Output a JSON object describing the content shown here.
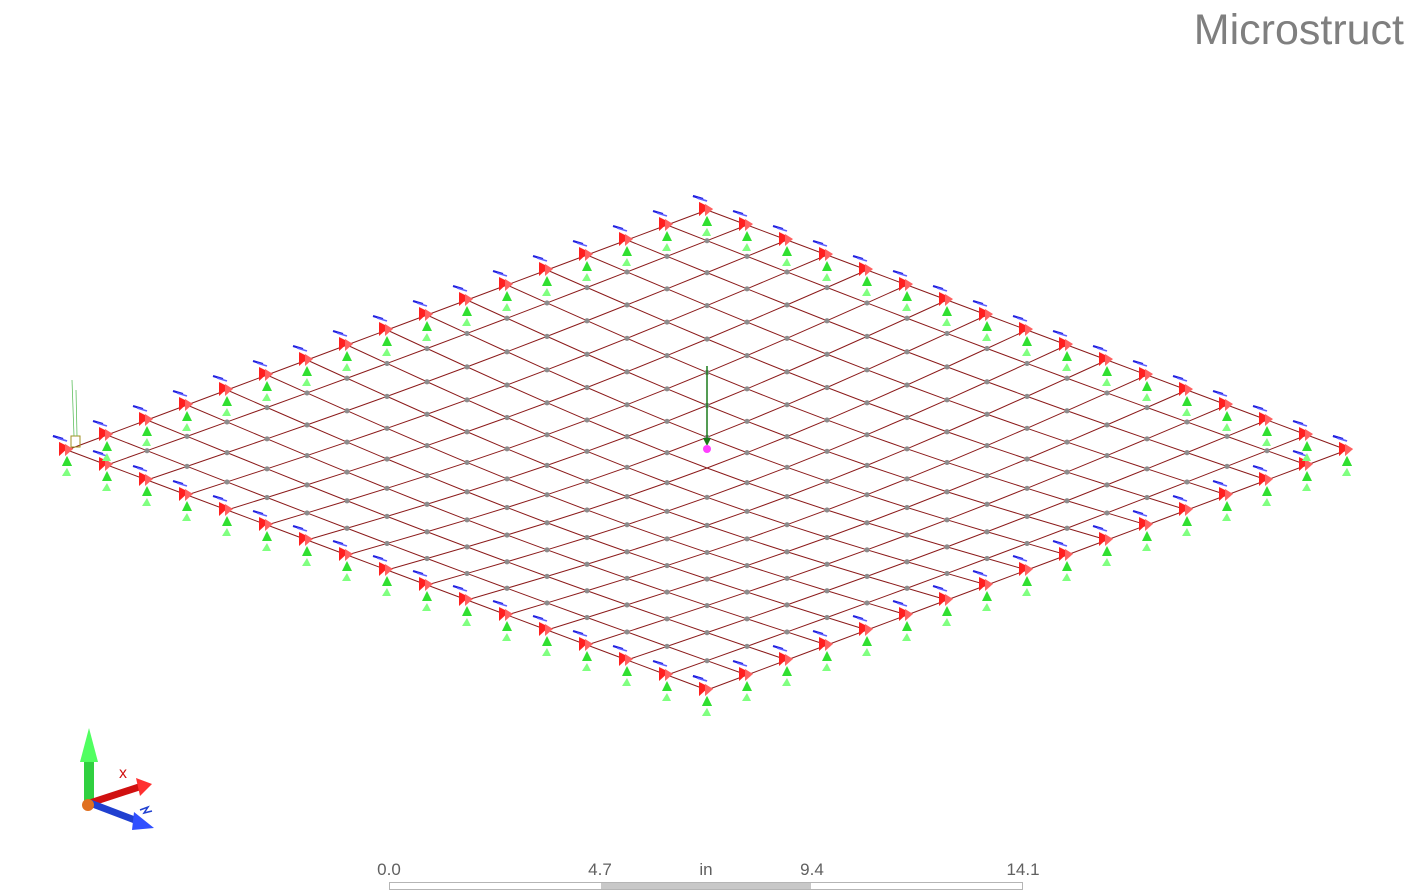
{
  "app": {
    "watermark": "Microstruct"
  },
  "axis_triad": {
    "x_label": "x",
    "icon": "xyz-axis-triad-icon"
  },
  "scale_bar": {
    "ticks": [
      "0.0",
      "4.7",
      "9.4",
      "14.1"
    ],
    "unit": "in",
    "segment_fill": [
      "#ffffff",
      "#c8c8c8",
      "#ffffff"
    ]
  },
  "model": {
    "mesh_color": "#8b1a1a",
    "node_color": "#8c8c8c",
    "support_colors": {
      "x": "#ff2020",
      "y": "#30e030",
      "z": "#2020e0"
    },
    "load_marker_color": "#ff40ff",
    "load_arrow_color": "#1a7a1a"
  }
}
